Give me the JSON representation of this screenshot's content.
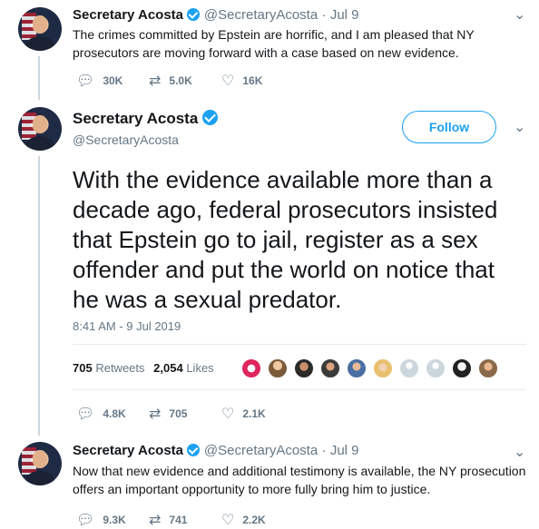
{
  "tweet1": {
    "name": "Secretary Acosta",
    "handle": "@SecretaryAcosta",
    "time": "· Jul 9",
    "text": "The crimes committed by Epstein are horrific, and I am pleased that NY prosecutors are moving forward with a case based on new evidence.",
    "replies": "30K",
    "retweets": "5.0K",
    "likes": "16K"
  },
  "main": {
    "name": "Secretary Acosta",
    "handle": "@SecretaryAcosta",
    "follow_label": "Follow",
    "text": "With the evidence available more than a decade ago, federal prosecutors insisted that Epstein go to jail, register as a sex offender and put the world on notice that he was a sexual predator.",
    "timestamp": "8:41 AM - 9 Jul 2019",
    "retweet_count": "705",
    "retweet_label": "Retweets",
    "like_count": "2,054",
    "like_label": "Likes",
    "replies": "4.8K",
    "retweets": "705",
    "likes": "2.1K"
  },
  "tweet3": {
    "name": "Secretary Acosta",
    "handle": "@SecretaryAcosta",
    "time": "· Jul 9",
    "text": "Now that new evidence and additional testimony is available, the NY prosecution offers an important opportunity to more fully bring him to justice.",
    "replies": "9.3K",
    "retweets": "741",
    "likes": "2.2K"
  },
  "colors": {
    "accent": "#1da1f2",
    "muted": "#657786",
    "thread_line": "#ccd6dd"
  },
  "icons": {
    "reply": "reply-icon",
    "retweet": "retweet-icon",
    "like": "heart-icon",
    "more": "chevron-down-icon",
    "verified": "verified-badge-icon"
  }
}
